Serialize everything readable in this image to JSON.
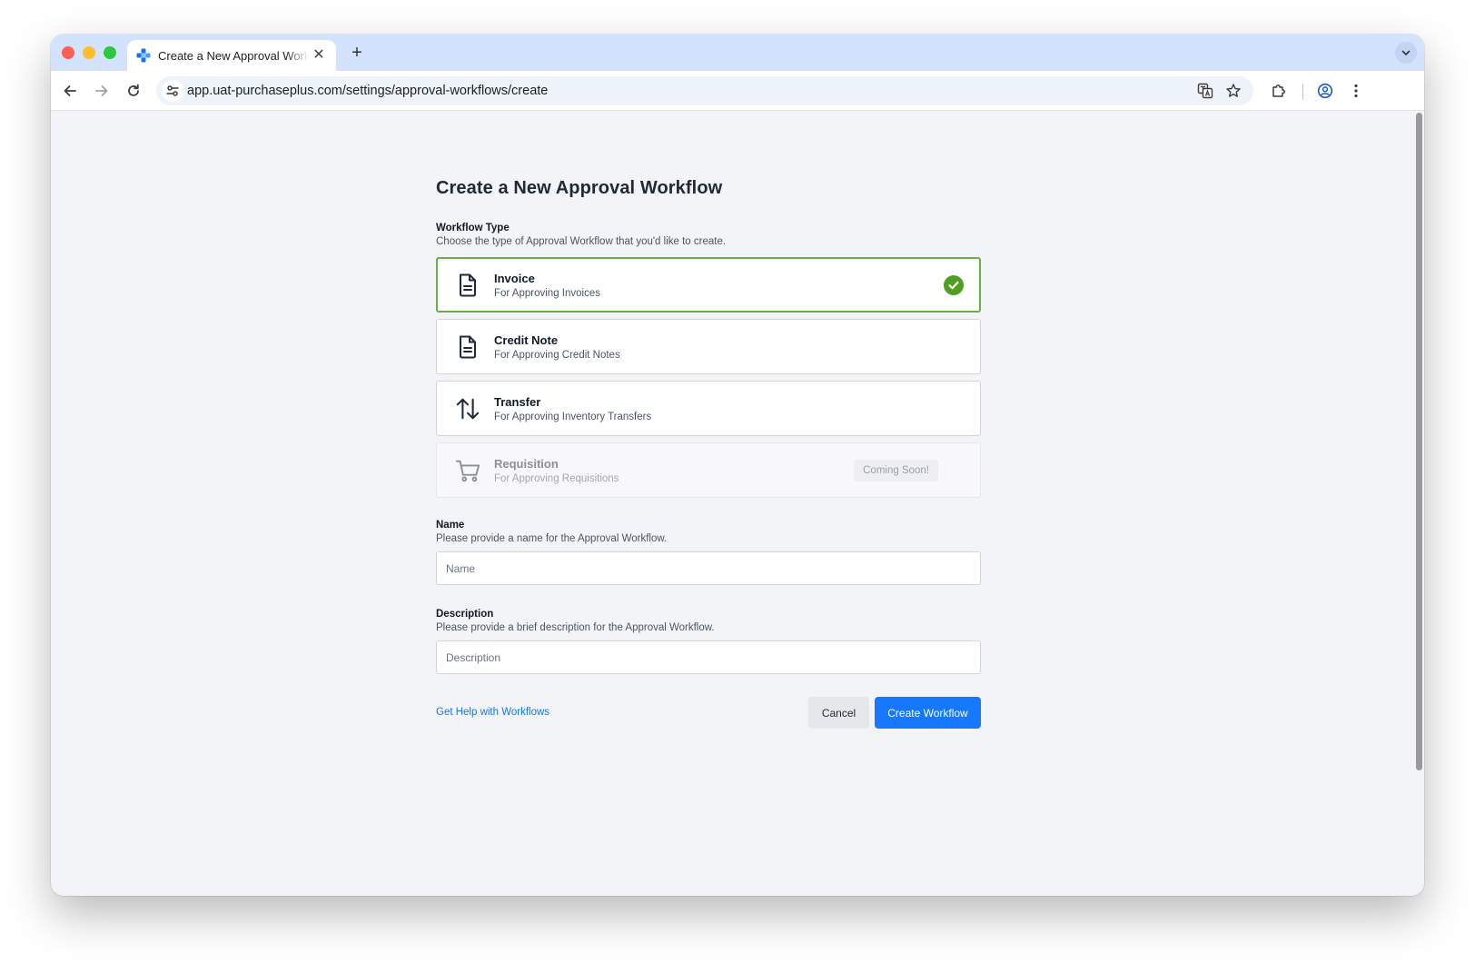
{
  "browser": {
    "tab_title": "Create a New Approval Workflow",
    "tab_close": "✕",
    "new_tab": "+",
    "url_host": "app.uat-purchaseplus.com",
    "url_path": "/settings/approval-workflows/create"
  },
  "page": {
    "title": "Create a New Approval Workflow",
    "workflow_type": {
      "label": "Workflow Type",
      "description": "Choose the type of Approval Workflow that you'd like to create.",
      "options": [
        {
          "name": "Invoice",
          "description": "For Approving Invoices",
          "icon": "document-icon",
          "state": "selected"
        },
        {
          "name": "Credit Note",
          "description": "For Approving Credit Notes",
          "icon": "document-icon",
          "state": "available"
        },
        {
          "name": "Transfer",
          "description": "For Approving Inventory Transfers",
          "icon": "arrows-up-down-icon",
          "state": "available"
        },
        {
          "name": "Requisition",
          "description": "For Approving Requisitions",
          "icon": "shopping-cart-icon",
          "state": "disabled",
          "badge": "Coming Soon!"
        }
      ]
    },
    "name_field": {
      "label": "Name",
      "description": "Please provide a name for the Approval Workflow.",
      "placeholder": "Name",
      "value": ""
    },
    "description_field": {
      "label": "Description",
      "description": "Please provide a brief description for the Approval Workflow.",
      "placeholder": "Description",
      "value": ""
    },
    "help_link": "Get Help with Workflows",
    "cancel_label": "Cancel",
    "create_label": "Create Workflow"
  },
  "colors": {
    "accent": "#1677ff",
    "selected_border": "#6aae47",
    "check": "#4f9e1f",
    "link": "#1677e8"
  }
}
